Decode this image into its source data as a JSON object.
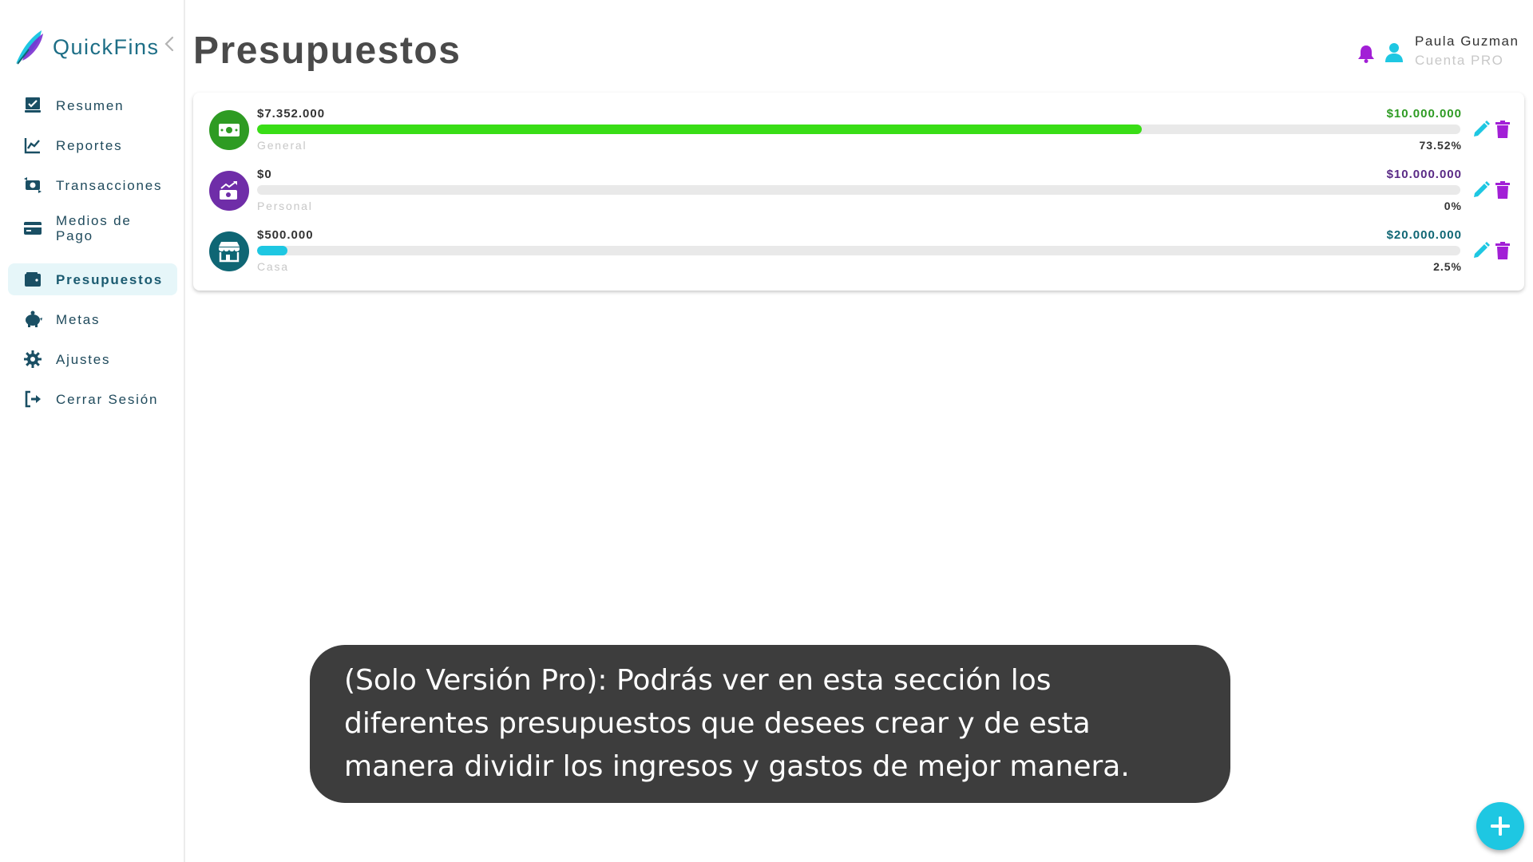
{
  "app": {
    "name": "QuickFins"
  },
  "sidebar": {
    "items": [
      {
        "label": "Resumen",
        "icon": "summary-icon",
        "active": false
      },
      {
        "label": "Reportes",
        "icon": "chart-line-icon",
        "active": false
      },
      {
        "label": "Transacciones",
        "icon": "money-exchange-icon",
        "active": false
      },
      {
        "label": "Medios de Pago",
        "icon": "credit-card-icon",
        "active": false
      },
      {
        "label": "Presupuestos",
        "icon": "wallet-icon",
        "active": true
      },
      {
        "label": "Metas",
        "icon": "piggy-bank-icon",
        "active": false
      },
      {
        "label": "Ajustes",
        "icon": "gear-icon",
        "active": false
      },
      {
        "label": "Cerrar Sesión",
        "icon": "logout-icon",
        "active": false
      }
    ]
  },
  "header": {
    "title": "Presupuestos",
    "user": {
      "name": "Paula Guzman",
      "plan": "Cuenta PRO"
    }
  },
  "budgets": [
    {
      "category": "General",
      "spent": "$7.352.000",
      "limit": "$10.000.000",
      "percent_label": "73.52%",
      "progress": 0.7352,
      "icon": "cash-icon",
      "icon_color": "#2e9b23",
      "bar_color": "#39dd16",
      "limit_color": "#2e9b23"
    },
    {
      "category": "Personal",
      "spent": "$0",
      "limit": "$10.000.000",
      "percent_label": "0%",
      "progress": 0,
      "icon": "money-growth-icon",
      "icon_color": "#6f2da8",
      "bar_color": "#7a2fb8",
      "limit_color": "#5a2a86"
    },
    {
      "category": "Casa",
      "spent": "$500.000",
      "limit": "$20.000.000",
      "percent_label": "2.5%",
      "progress": 0.025,
      "icon": "store-icon",
      "icon_color": "#0f6674",
      "bar_color": "#1ec7e2",
      "limit_color": "#0f6674"
    }
  ],
  "tooltip": {
    "lines": [
      "(Solo Versión Pro): Podrás ver en esta sección los",
      "diferentes presupuestos que desees crear y de esta",
      "manera dividir los ingresos y gastos de mejor manera."
    ]
  },
  "colors": {
    "accent": "#1ec7e2",
    "brand": "#1d6e86",
    "purple": "#a21fd6",
    "active_bg": "#e6f6f9"
  }
}
